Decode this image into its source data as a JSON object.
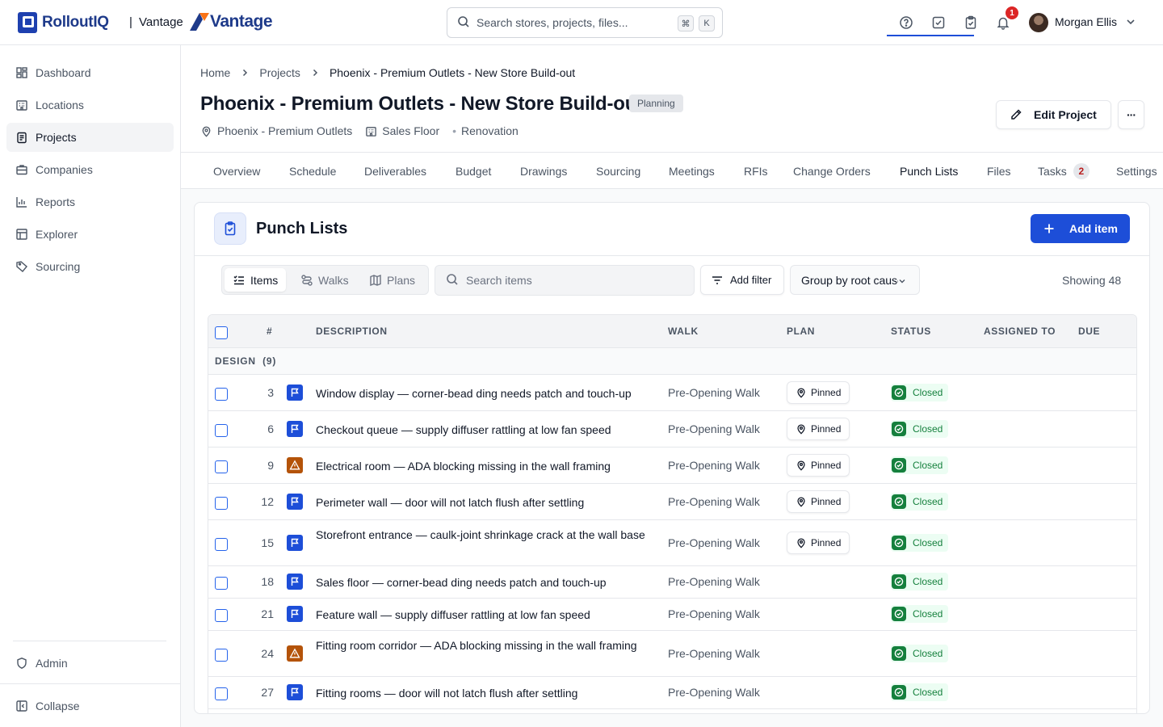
{
  "header": {
    "brand": "RolloutIQ",
    "separator": "|",
    "tenant": "Vantage",
    "tenant_logo_text": "Vantage",
    "search_placeholder": "Search stores, projects, files...",
    "shortcut_keys": [
      "⌘",
      "K"
    ],
    "notification_count": "1",
    "user_name": "Morgan Ellis",
    "icons": [
      "help-icon",
      "checklist-icon",
      "clipboard-check-icon",
      "bell-icon"
    ]
  },
  "sidebar": {
    "items": [
      {
        "label": "Dashboard",
        "icon": "dashboard-icon"
      },
      {
        "label": "Locations",
        "icon": "building-icon"
      },
      {
        "label": "Projects",
        "icon": "clipboard-icon",
        "active": true
      },
      {
        "label": "Companies",
        "icon": "briefcase-icon"
      },
      {
        "label": "Reports",
        "icon": "bar-chart-icon"
      },
      {
        "label": "Explorer",
        "icon": "table-icon"
      },
      {
        "label": "Sourcing",
        "icon": "tag-icon"
      }
    ],
    "admin_label": "Admin",
    "collapse_label": "Collapse"
  },
  "breadcrumb": [
    "Home",
    "Projects",
    "Phoenix - Premium Outlets - New Store Build-out"
  ],
  "project": {
    "title": "Phoenix - Premium Outlets - New Store Build-out",
    "status": "Planning",
    "location": "Phoenix - Premium Outlets",
    "area": "Sales Floor",
    "type": "Renovation",
    "edit_label": "Edit Project",
    "more_label": "···"
  },
  "tabs": [
    {
      "label": "Overview"
    },
    {
      "label": "Schedule"
    },
    {
      "label": "Deliverables"
    },
    {
      "label": "Budget"
    },
    {
      "label": "Drawings"
    },
    {
      "label": "Sourcing"
    },
    {
      "label": "Meetings"
    },
    {
      "label": "RFIs"
    },
    {
      "label": "Change Orders"
    },
    {
      "label": "Punch Lists",
      "active": true
    },
    {
      "label": "Files"
    },
    {
      "label": "Tasks",
      "count": "2"
    },
    {
      "label": "Settings"
    }
  ],
  "punch": {
    "title": "Punch Lists",
    "add_label": "Add item",
    "views": [
      "Items",
      "Walks",
      "Plans"
    ],
    "search_placeholder": "Search items",
    "filter_label": "Add filter",
    "group_by": "Group by root cause",
    "showing": "Showing 48",
    "columns": [
      "#",
      "DESCRIPTION",
      "WALK",
      "PLAN",
      "STATUS",
      "ASSIGNED TO",
      "DUE"
    ],
    "group": {
      "name": "DESIGN",
      "count": "(9)"
    },
    "rows": [
      {
        "num": "3",
        "type": "flag",
        "desc": "Window display — corner-bead ding needs patch and touch-up",
        "walk": "Pre-Opening Walk",
        "plan": "Pinned",
        "status": "Closed"
      },
      {
        "num": "6",
        "type": "flag",
        "desc": "Checkout queue — supply diffuser rattling at low fan speed",
        "walk": "Pre-Opening Walk",
        "plan": "Pinned",
        "status": "Closed"
      },
      {
        "num": "9",
        "type": "warning",
        "desc": "Electrical room — ADA blocking missing in the wall framing",
        "walk": "Pre-Opening Walk",
        "plan": "Pinned",
        "status": "Closed"
      },
      {
        "num": "12",
        "type": "flag",
        "desc": "Perimeter wall — door will not latch flush after settling",
        "walk": "Pre-Opening Walk",
        "plan": "Pinned",
        "status": "Closed"
      },
      {
        "num": "15",
        "type": "flag",
        "desc": "Storefront entrance — caulk-joint shrinkage crack at the wall base",
        "walk": "Pre-Opening Walk",
        "plan": "Pinned",
        "status": "Closed"
      },
      {
        "num": "18",
        "type": "flag",
        "desc": "Sales floor — corner-bead ding needs patch and touch-up",
        "walk": "Pre-Opening Walk",
        "plan": "",
        "status": "Closed"
      },
      {
        "num": "21",
        "type": "flag",
        "desc": "Feature wall — supply diffuser rattling at low fan speed",
        "walk": "Pre-Opening Walk",
        "plan": "",
        "status": "Closed"
      },
      {
        "num": "24",
        "type": "warning",
        "desc": "Fitting room corridor — ADA blocking missing in the wall framing",
        "walk": "Pre-Opening Walk",
        "plan": "",
        "status": "Closed"
      },
      {
        "num": "27",
        "type": "flag",
        "desc": "Fitting rooms — door will not latch flush after settling",
        "walk": "Pre-Opening Walk",
        "plan": "",
        "status": "Closed"
      }
    ]
  },
  "colors": {
    "accent": "#1d4ed8",
    "brand": "#1e3a8a",
    "success": "#15803d",
    "warning": "#b45309",
    "danger": "#dc2626"
  }
}
